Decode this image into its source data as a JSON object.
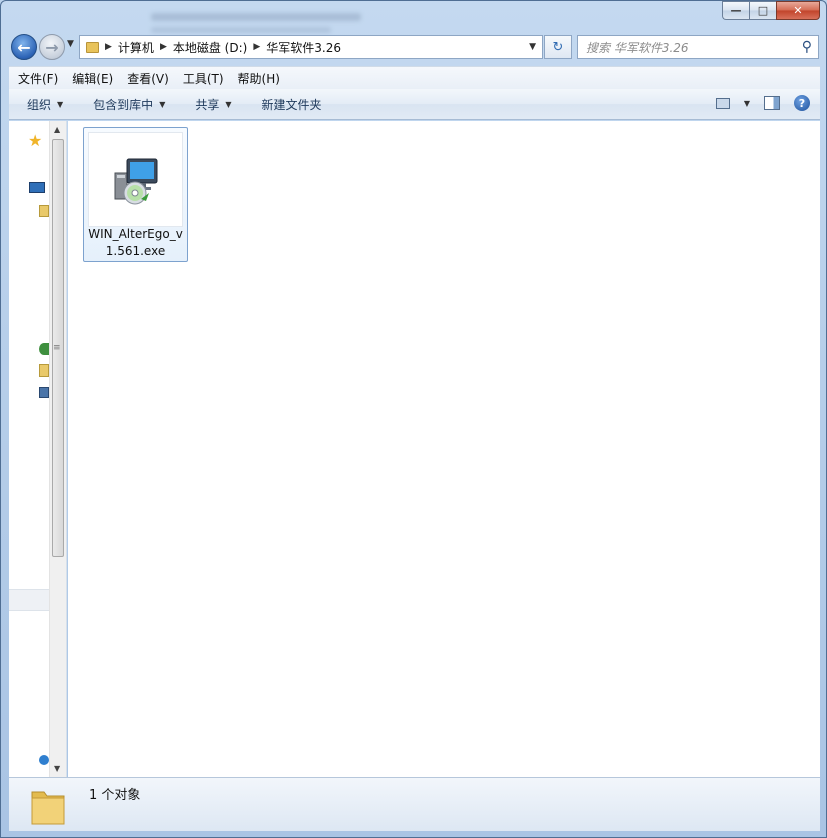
{
  "window": {
    "minimize_glyph": "—",
    "maximize_glyph": "□",
    "close_glyph": "✕"
  },
  "navigation": {
    "back_glyph": "←",
    "forward_glyph": "→",
    "breadcrumbs": [
      "计算机",
      "本地磁盘 (D:)",
      "华军软件3.26"
    ],
    "refresh_glyph": "↻",
    "search_placeholder": "搜索 华军软件3.26"
  },
  "menu": {
    "items": [
      "文件(F)",
      "编辑(E)",
      "查看(V)",
      "工具(T)",
      "帮助(H)"
    ]
  },
  "commands": {
    "organize": "组织",
    "include_in_library": "包含到库中",
    "share": "共享",
    "new_folder": "新建文件夹",
    "help_glyph": "?"
  },
  "files": [
    {
      "name": "WIN_AlterEgo_v1.561.exe",
      "icon": "installer-icon"
    }
  ],
  "status": {
    "item_count": "1 个对象"
  }
}
